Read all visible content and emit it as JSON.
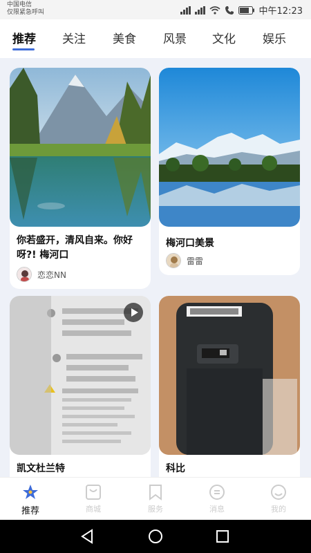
{
  "status_bar": {
    "carrier_line1": "中国电信",
    "carrier_line2": "仅限紧急呼叫",
    "battery": "",
    "time": "中午12:23"
  },
  "tabs": [
    {
      "label": "推荐",
      "active": true
    },
    {
      "label": "关注"
    },
    {
      "label": "美食"
    },
    {
      "label": "风景"
    },
    {
      "label": "文化"
    },
    {
      "label": "娱乐"
    }
  ],
  "feed": {
    "cards": [
      {
        "title": "你若盛开，清风自来。你好呀?! 梅河口",
        "author": "恋恋NN",
        "image": "mountain-lake-forest"
      },
      {
        "title": "梅河口美景",
        "author": "雷雷",
        "image": "snow-mountain-lake"
      },
      {
        "title": "凯文杜兰特",
        "image": "laptop-screen-code",
        "has_video": true
      },
      {
        "title": "科比",
        "image": "scanner-device"
      }
    ]
  },
  "bottom_nav": [
    {
      "label": "推荐",
      "icon": "star-icon",
      "active": true
    },
    {
      "label": "商城",
      "icon": "mall-icon"
    },
    {
      "label": "服务",
      "icon": "bookmark-icon"
    },
    {
      "label": "消息",
      "icon": "message-icon"
    },
    {
      "label": "我的",
      "icon": "profile-icon"
    }
  ],
  "colors": {
    "accent": "#3d6bd8",
    "feed_bg": "#eef1f8"
  }
}
